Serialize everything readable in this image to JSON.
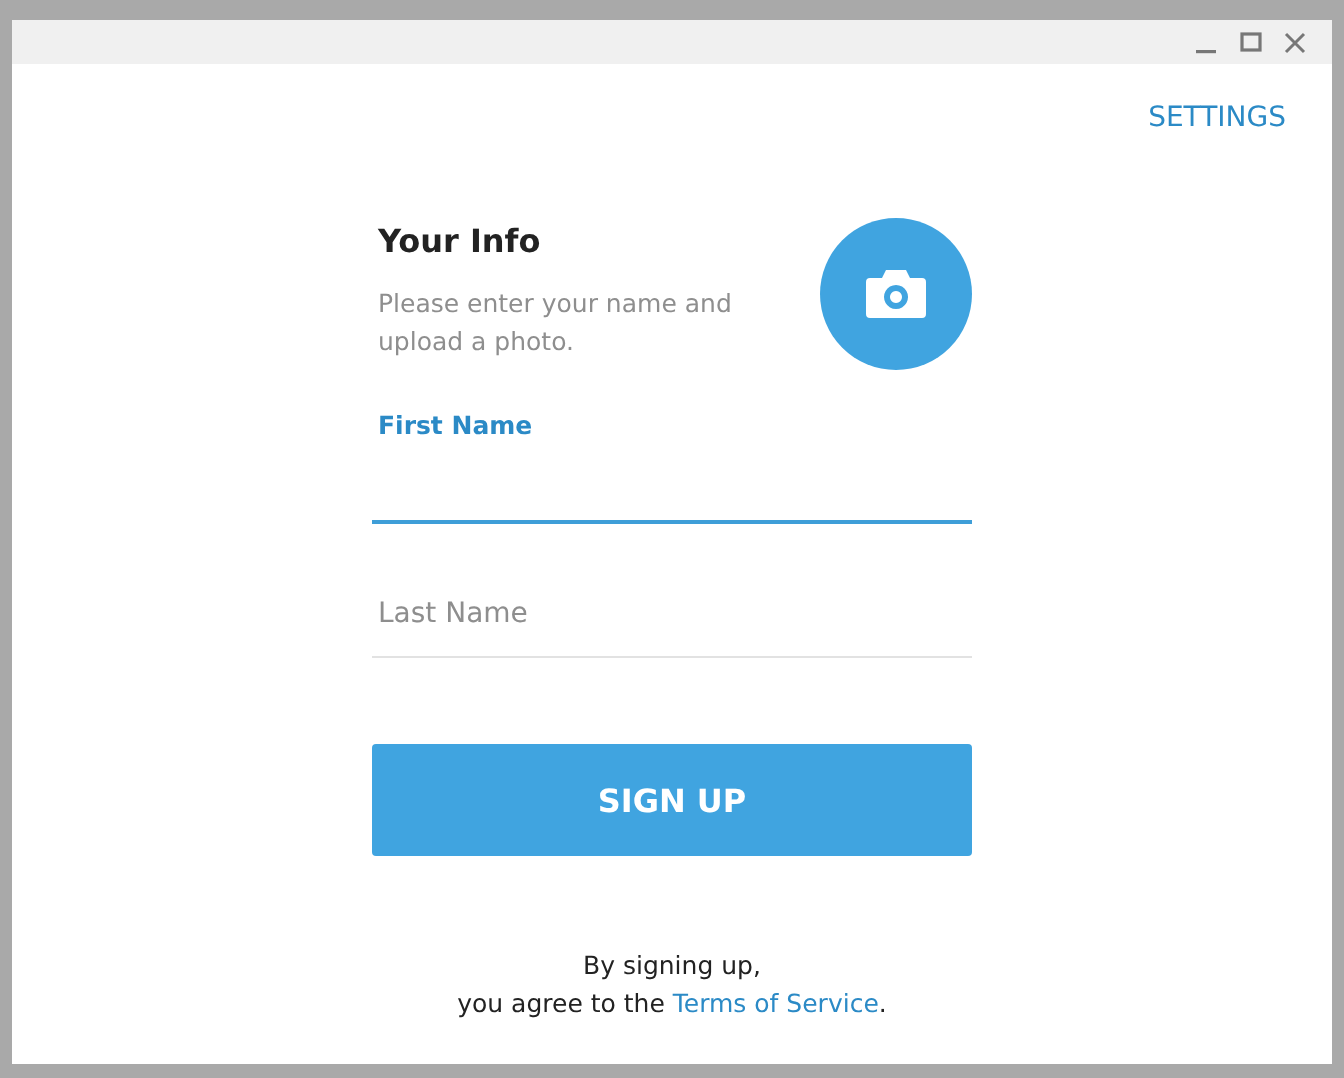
{
  "window": {
    "controls": [
      {
        "kind": "minimize"
      },
      {
        "kind": "maximize"
      },
      {
        "kind": "close"
      }
    ]
  },
  "settings_link": "SETTINGS",
  "form": {
    "title": "Your Info",
    "subtitle": "Please enter your name and upload a photo.",
    "fields": [
      {
        "label": "First Name",
        "focused": true
      },
      {
        "label": "Last Name",
        "focused": false
      }
    ],
    "submit": "SIGN UP"
  },
  "footer": {
    "line_1": "By signing up,",
    "line_2": "you agree to the ",
    "link": "Terms of Service",
    "end": "."
  }
}
